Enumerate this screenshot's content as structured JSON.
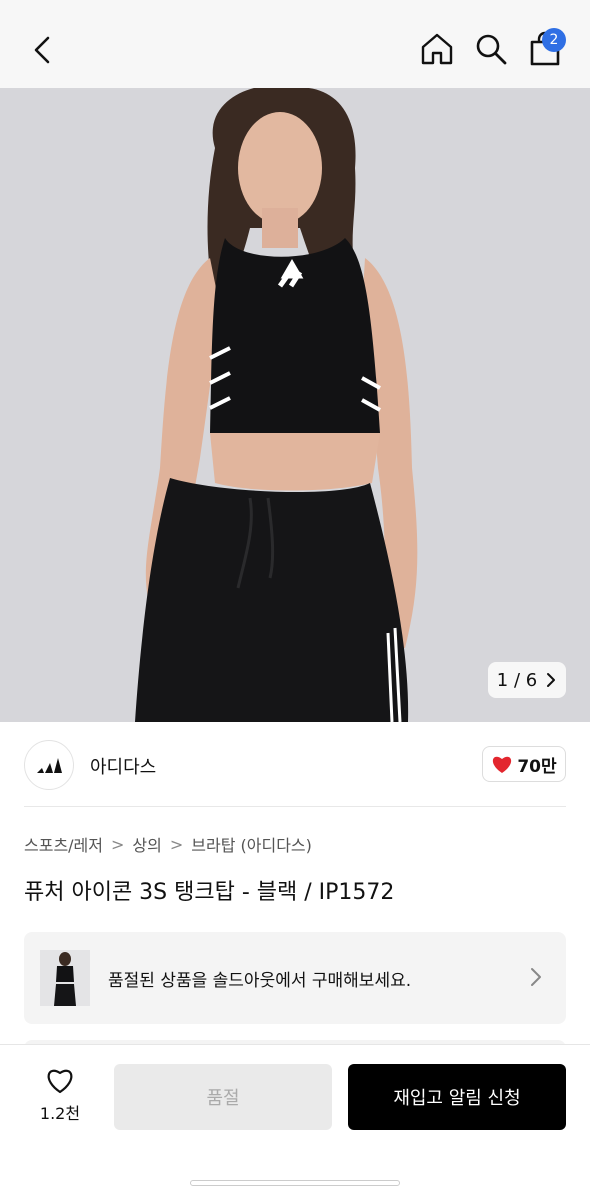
{
  "header": {
    "back_icon": "chevron-left-icon",
    "home_icon": "home-icon",
    "search_icon": "search-icon",
    "cart_icon": "shopping-bag-icon",
    "cart_badge": "2",
    "cart_badge_color": "#2f6fe4"
  },
  "gallery": {
    "counter": "1 / 6",
    "next_icon": "chevron-right-icon"
  },
  "brand": {
    "name": "아디다스",
    "like_count": "70만",
    "like_color": "#e3262e"
  },
  "breadcrumb": {
    "items": [
      "스포츠/레저",
      "상의",
      "브라탑 (아디다스)"
    ],
    "separator": ">"
  },
  "product": {
    "title": "퓨처 아이콘 3S 탱크탑 - 블랙 / IP1572"
  },
  "soldout_notice": {
    "text": "품절된 상품을 솔드아웃에서 구매해보세요."
  },
  "bottom": {
    "wish_count": "1.2천",
    "soldout_label": "품절",
    "restock_label": "재입고 알림 신청"
  }
}
